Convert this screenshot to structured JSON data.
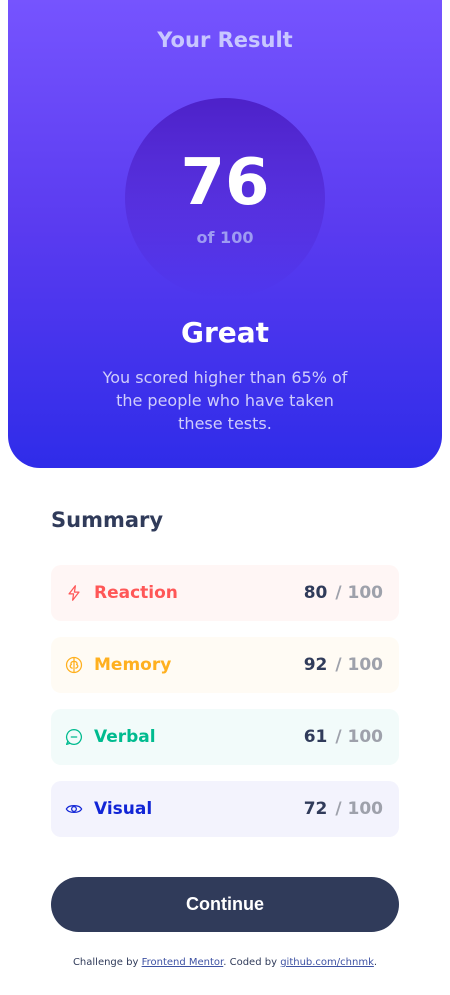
{
  "result": {
    "title": "Your Result",
    "score": "76",
    "of_label": "of 100",
    "rating": "Great",
    "description": "You scored higher than 65% of the people who have taken these tests."
  },
  "summary": {
    "title": "Summary",
    "items": [
      {
        "label": "Reaction",
        "value": "80",
        "max": "/ 100",
        "icon": "lightning-icon",
        "color": "#ff5757",
        "bg": "#fff6f5"
      },
      {
        "label": "Memory",
        "value": "92",
        "max": "/ 100",
        "icon": "brain-icon",
        "color": "#ffb01f",
        "bg": "#fffbf4"
      },
      {
        "label": "Verbal",
        "value": "61",
        "max": "/ 100",
        "icon": "chat-icon",
        "color": "#00bb8f",
        "bg": "#f2fbfa"
      },
      {
        "label": "Visual",
        "value": "72",
        "max": "/ 100",
        "icon": "eye-icon",
        "color": "#1125d6",
        "bg": "#f3f3fd"
      }
    ]
  },
  "button": {
    "label": "Continue"
  },
  "attribution": {
    "prefix": "Challenge by",
    "link1": "Frontend Mentor",
    "middle": ". Coded by",
    "link2": "github.com/chnmk",
    "suffix": "."
  }
}
